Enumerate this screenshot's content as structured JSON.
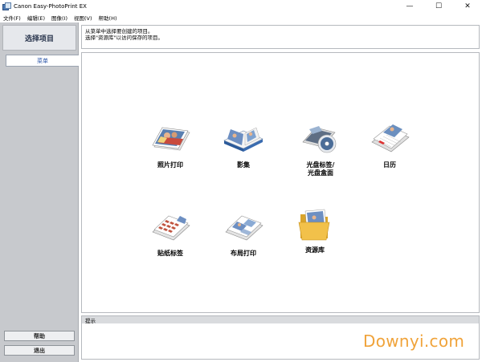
{
  "window": {
    "title": "Canon Easy-PhotoPrint EX",
    "min_glyph": "—",
    "max_glyph": "☐",
    "close_glyph": "✕"
  },
  "menubar": {
    "items": [
      "文件(F)",
      "编辑(E)",
      "图像(I)",
      "视图(V)",
      "帮助(H)"
    ]
  },
  "sidebar": {
    "header": "选择项目",
    "tab": "菜单",
    "help_button": "帮助",
    "exit_button": "退出"
  },
  "info": {
    "line1": "从菜单中选择要创建的项目。",
    "line2": "选择\"资源库\"以访问保存的项目。"
  },
  "tiles": {
    "photo_print": "照片打印",
    "album": "影集",
    "disc_label_1": "光盘标签/",
    "disc_label_2": "光盘盒面",
    "calendar": "日历",
    "sticker": "贴纸标签",
    "layout_print": "布局打印",
    "library": "资源库"
  },
  "hint": {
    "title": "提示"
  },
  "watermark": "Downyi.com"
}
